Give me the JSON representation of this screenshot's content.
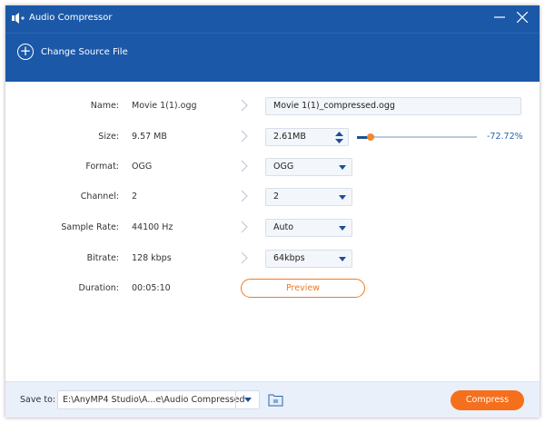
{
  "window": {
    "title": "Audio Compressor",
    "minimize_icon": "minimize-icon",
    "close_icon": "close-icon"
  },
  "header": {
    "change_source_label": "Change Source File"
  },
  "fields": {
    "name": {
      "label": "Name:",
      "source": "Movie 1(1).ogg",
      "output": "Movie 1(1)_compressed.ogg"
    },
    "size": {
      "label": "Size:",
      "source": "9.57 MB",
      "output": "2.61MB",
      "percent": "-72.72%",
      "slider_fraction": 0.11
    },
    "format": {
      "label": "Format:",
      "source": "OGG",
      "output": "OGG"
    },
    "channel": {
      "label": "Channel:",
      "source": "2",
      "output": "2"
    },
    "sample_rate": {
      "label": "Sample Rate:",
      "source": "44100 Hz",
      "output": "Auto"
    },
    "bitrate": {
      "label": "Bitrate:",
      "source": "128 kbps",
      "output": "64kbps"
    },
    "duration": {
      "label": "Duration:",
      "source": "00:05:10"
    }
  },
  "preview_label": "Preview",
  "footer": {
    "save_to_label": "Save to:",
    "path": "E:\\AnyMP4 Studio\\A...e\\Audio Compressed",
    "compress_label": "Compress"
  },
  "colors": {
    "primary": "#1b58a8",
    "accent": "#f56f1c"
  }
}
